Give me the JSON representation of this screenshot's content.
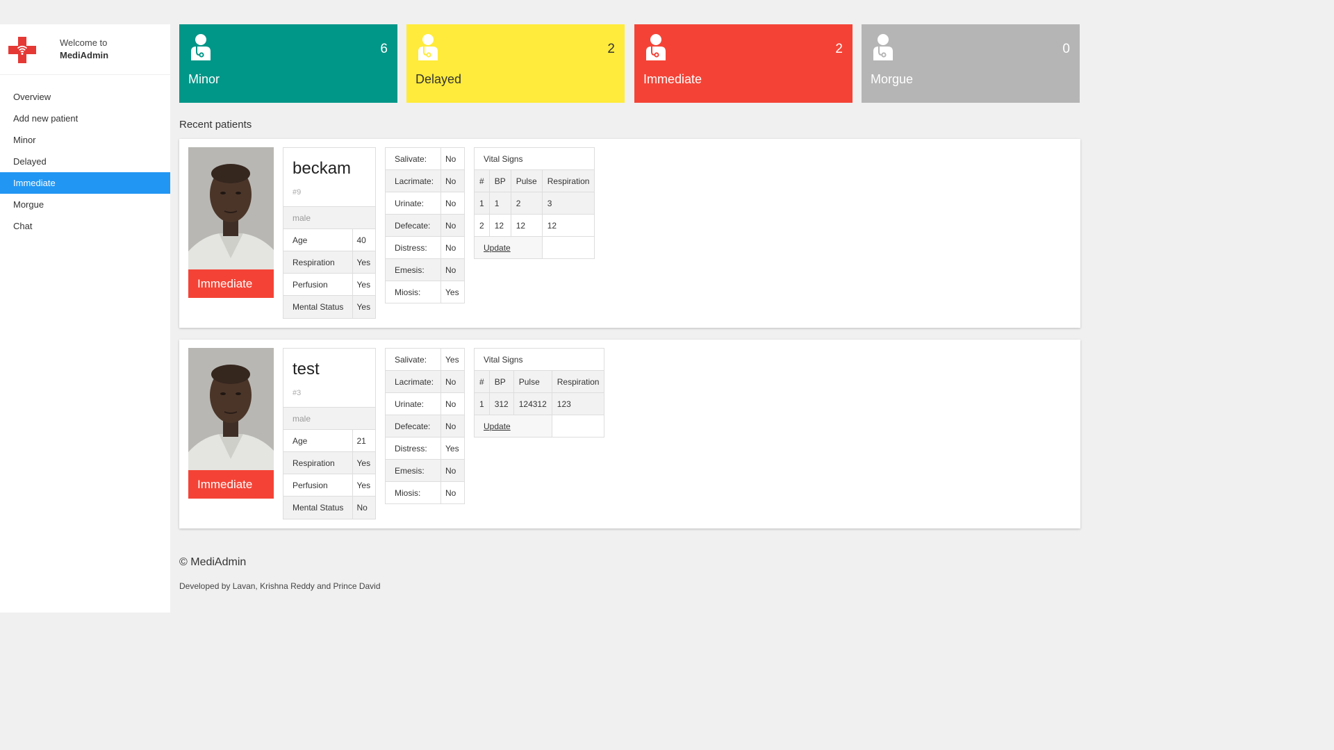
{
  "brand": {
    "welcome": "Welcome to",
    "name": "MediAdmin",
    "logo_icon": "medical-cross-wifi-icon",
    "logo_color": "#e53935"
  },
  "nav": {
    "items": [
      {
        "label": "Overview"
      },
      {
        "label": "Add new patient"
      },
      {
        "label": "Minor"
      },
      {
        "label": "Delayed"
      },
      {
        "label": "Immediate",
        "active": true
      },
      {
        "label": "Morgue"
      },
      {
        "label": "Chat"
      }
    ],
    "active_color": "#2196f3"
  },
  "stats": [
    {
      "label": "Minor",
      "count": "6",
      "color": "#009688",
      "icon": "patient-icon"
    },
    {
      "label": "Delayed",
      "count": "2",
      "color": "#ffeb3b",
      "icon": "patient-icon"
    },
    {
      "label": "Immediate",
      "count": "2",
      "color": "#f44336",
      "icon": "patient-icon"
    },
    {
      "label": "Morgue",
      "count": "0",
      "color": "#b5b5b5",
      "icon": "patient-icon"
    }
  ],
  "section_title": "Recent patients",
  "patients": [
    {
      "name": "beckam",
      "id": "#9",
      "gender": "male",
      "triage": "Immediate",
      "fields": [
        {
          "label": "Age",
          "value": "40"
        },
        {
          "label": "Respiration",
          "value": "Yes"
        },
        {
          "label": "Perfusion",
          "value": "Yes"
        },
        {
          "label": "Mental Status",
          "value": "Yes"
        }
      ],
      "symptoms": [
        {
          "label": "Salivate:",
          "value": "No"
        },
        {
          "label": "Lacrimate:",
          "value": "No"
        },
        {
          "label": "Urinate:",
          "value": "No"
        },
        {
          "label": "Defecate:",
          "value": "No"
        },
        {
          "label": "Distress:",
          "value": "No"
        },
        {
          "label": "Emesis:",
          "value": "No"
        },
        {
          "label": "Miosis:",
          "value": "Yes"
        }
      ],
      "vitals": {
        "title": "Vital Signs",
        "headers": [
          "#",
          "BP",
          "Pulse",
          "Respiration"
        ],
        "rows": [
          [
            "1",
            "1",
            "2",
            "3"
          ],
          [
            "2",
            "12",
            "12",
            "12"
          ]
        ],
        "update_label": "Update"
      }
    },
    {
      "name": "test",
      "id": "#3",
      "gender": "male",
      "triage": "Immediate",
      "fields": [
        {
          "label": "Age",
          "value": "21"
        },
        {
          "label": "Respiration",
          "value": "Yes"
        },
        {
          "label": "Perfusion",
          "value": "Yes"
        },
        {
          "label": "Mental Status",
          "value": "No"
        }
      ],
      "symptoms": [
        {
          "label": "Salivate:",
          "value": "Yes"
        },
        {
          "label": "Lacrimate:",
          "value": "No"
        },
        {
          "label": "Urinate:",
          "value": "No"
        },
        {
          "label": "Defecate:",
          "value": "No"
        },
        {
          "label": "Distress:",
          "value": "Yes"
        },
        {
          "label": "Emesis:",
          "value": "No"
        },
        {
          "label": "Miosis:",
          "value": "No"
        }
      ],
      "vitals": {
        "title": "Vital Signs",
        "headers": [
          "#",
          "BP",
          "Pulse",
          "Respiration"
        ],
        "rows": [
          [
            "1",
            "312",
            "124312",
            "123"
          ]
        ],
        "update_label": "Update"
      }
    }
  ],
  "footer": {
    "copyright": "© MediAdmin",
    "developers": "Developed by Lavan, Krishna Reddy and Prince David"
  }
}
